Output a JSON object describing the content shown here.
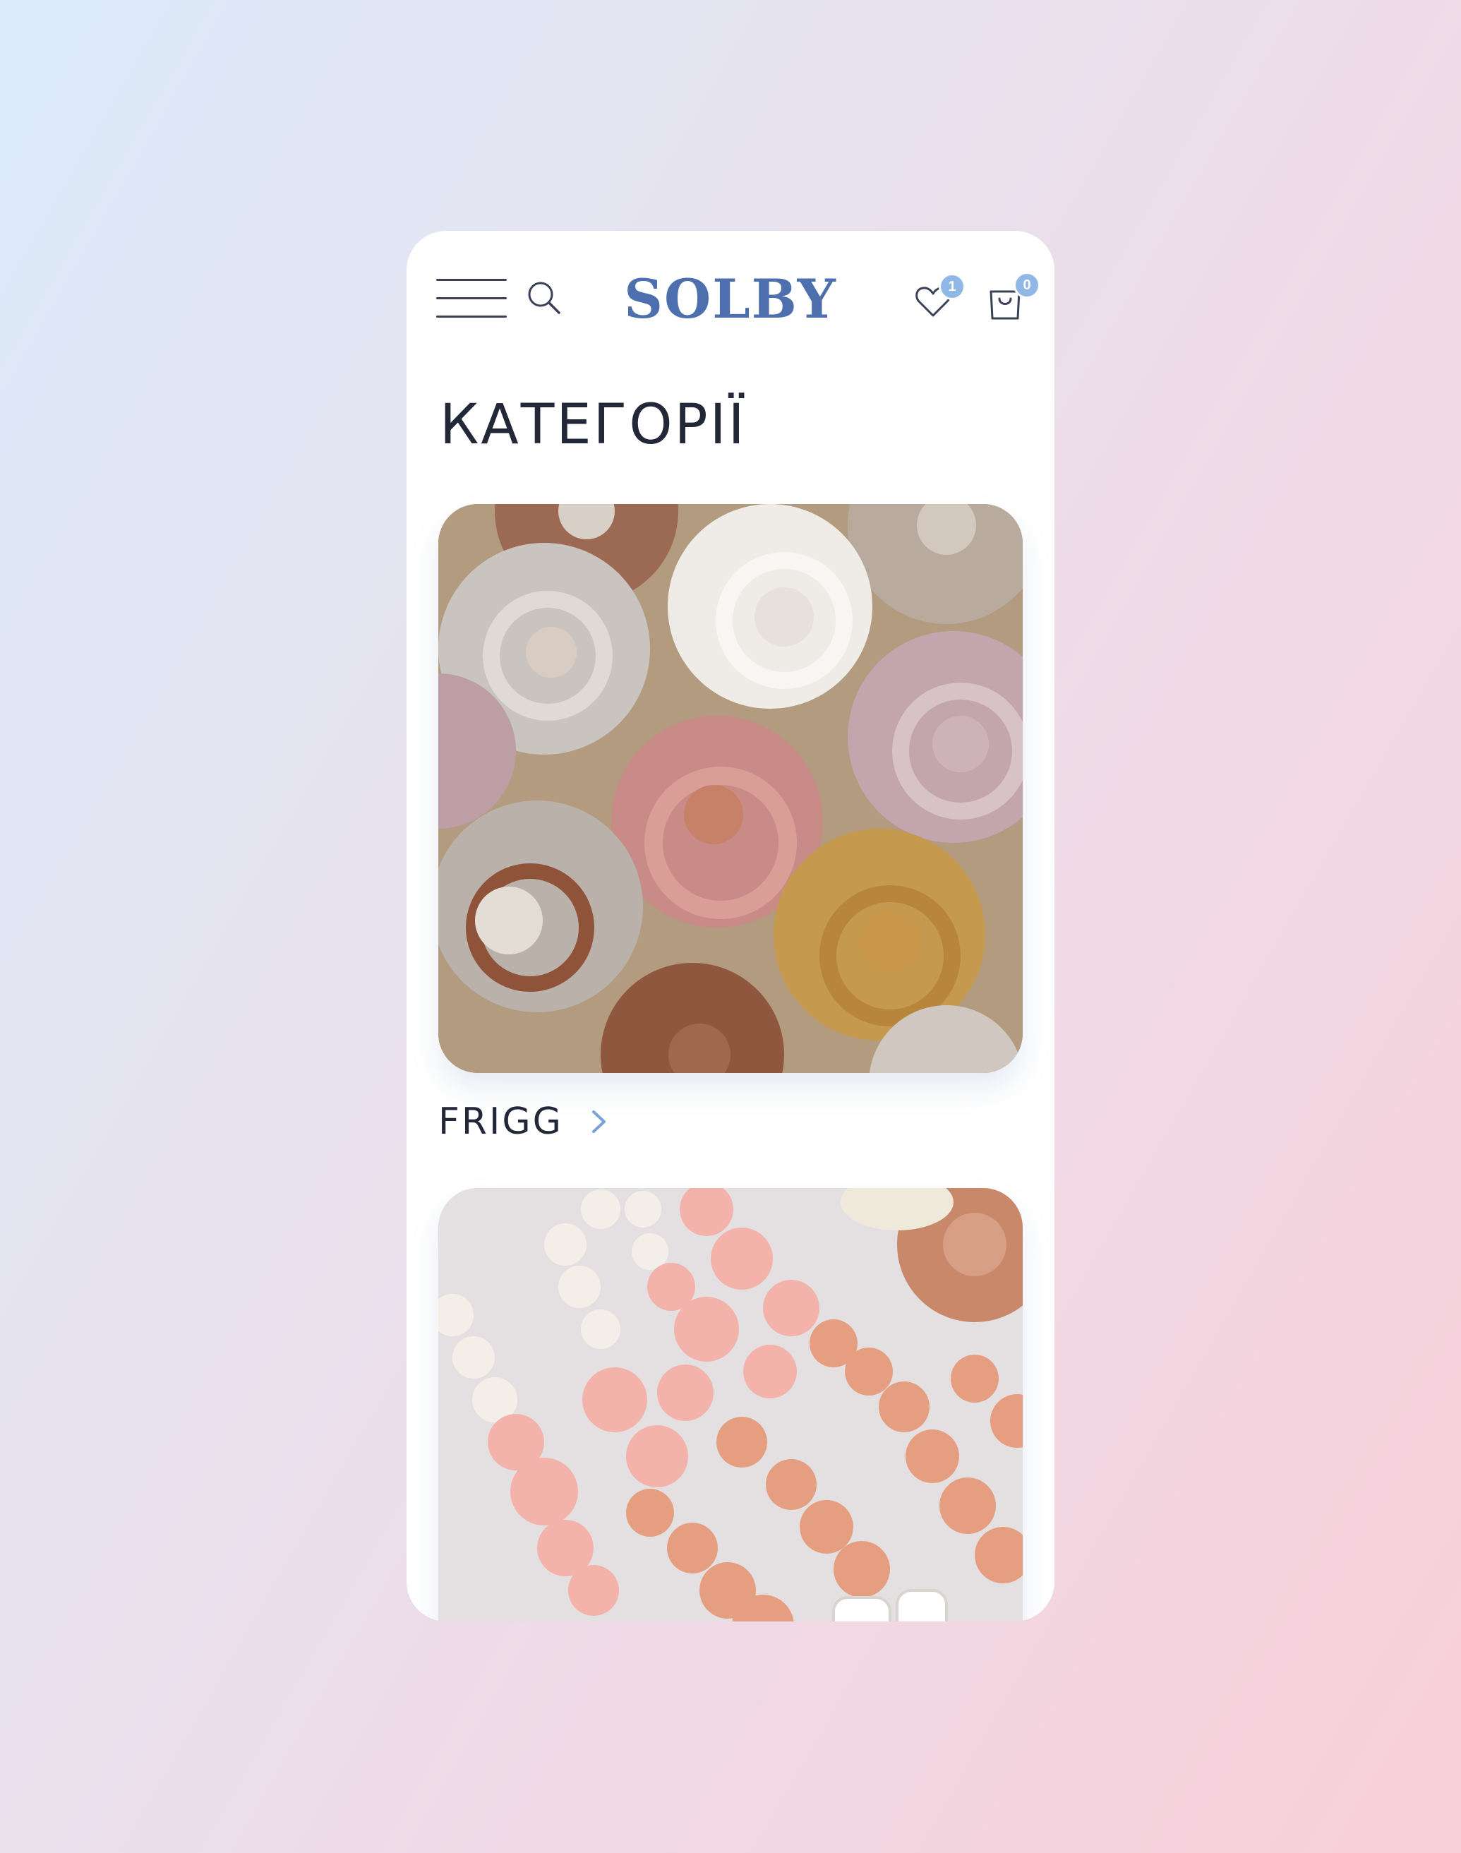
{
  "header": {
    "logo": "SOLBY",
    "wishlist_count": "1",
    "cart_count": "0",
    "icons": [
      "menu-icon",
      "search-icon",
      "heart-icon",
      "shopping-bag-icon"
    ]
  },
  "main": {
    "title": "КАТЕГОРІЇ",
    "categories": [
      {
        "label": "FRIGG",
        "image": "pacifiers-photo"
      },
      {
        "label": "",
        "image": "pacifier-clips-photo"
      }
    ]
  },
  "colors": {
    "brand": "#4e6fae",
    "badge": "#8fb8e6",
    "text": "#222838"
  }
}
